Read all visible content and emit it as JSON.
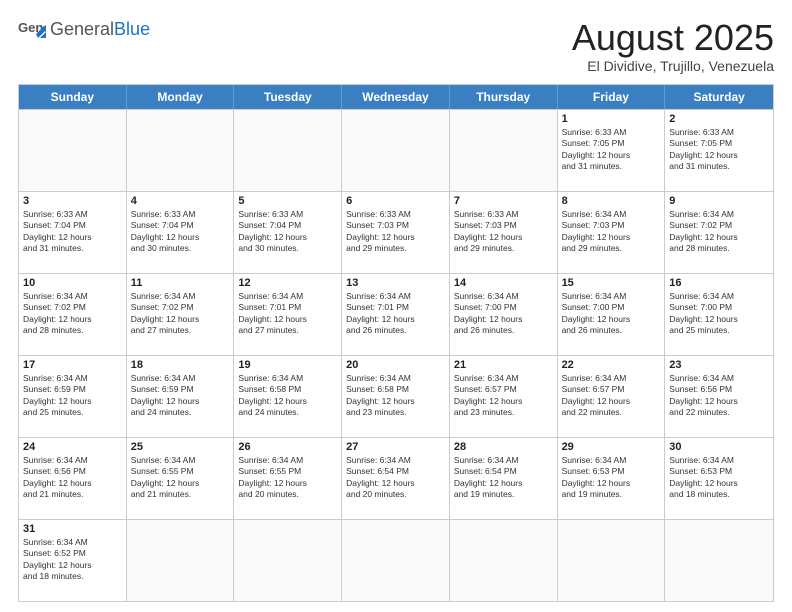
{
  "header": {
    "logo_general": "General",
    "logo_blue": "Blue",
    "month_title": "August 2025",
    "location": "El Dividive, Trujillo, Venezuela"
  },
  "weekdays": [
    "Sunday",
    "Monday",
    "Tuesday",
    "Wednesday",
    "Thursday",
    "Friday",
    "Saturday"
  ],
  "rows": [
    [
      {
        "day": "",
        "info": ""
      },
      {
        "day": "",
        "info": ""
      },
      {
        "day": "",
        "info": ""
      },
      {
        "day": "",
        "info": ""
      },
      {
        "day": "",
        "info": ""
      },
      {
        "day": "1",
        "info": "Sunrise: 6:33 AM\nSunset: 7:05 PM\nDaylight: 12 hours\nand 31 minutes."
      },
      {
        "day": "2",
        "info": "Sunrise: 6:33 AM\nSunset: 7:05 PM\nDaylight: 12 hours\nand 31 minutes."
      }
    ],
    [
      {
        "day": "3",
        "info": "Sunrise: 6:33 AM\nSunset: 7:04 PM\nDaylight: 12 hours\nand 31 minutes."
      },
      {
        "day": "4",
        "info": "Sunrise: 6:33 AM\nSunset: 7:04 PM\nDaylight: 12 hours\nand 30 minutes."
      },
      {
        "day": "5",
        "info": "Sunrise: 6:33 AM\nSunset: 7:04 PM\nDaylight: 12 hours\nand 30 minutes."
      },
      {
        "day": "6",
        "info": "Sunrise: 6:33 AM\nSunset: 7:03 PM\nDaylight: 12 hours\nand 29 minutes."
      },
      {
        "day": "7",
        "info": "Sunrise: 6:33 AM\nSunset: 7:03 PM\nDaylight: 12 hours\nand 29 minutes."
      },
      {
        "day": "8",
        "info": "Sunrise: 6:34 AM\nSunset: 7:03 PM\nDaylight: 12 hours\nand 29 minutes."
      },
      {
        "day": "9",
        "info": "Sunrise: 6:34 AM\nSunset: 7:02 PM\nDaylight: 12 hours\nand 28 minutes."
      }
    ],
    [
      {
        "day": "10",
        "info": "Sunrise: 6:34 AM\nSunset: 7:02 PM\nDaylight: 12 hours\nand 28 minutes."
      },
      {
        "day": "11",
        "info": "Sunrise: 6:34 AM\nSunset: 7:02 PM\nDaylight: 12 hours\nand 27 minutes."
      },
      {
        "day": "12",
        "info": "Sunrise: 6:34 AM\nSunset: 7:01 PM\nDaylight: 12 hours\nand 27 minutes."
      },
      {
        "day": "13",
        "info": "Sunrise: 6:34 AM\nSunset: 7:01 PM\nDaylight: 12 hours\nand 26 minutes."
      },
      {
        "day": "14",
        "info": "Sunrise: 6:34 AM\nSunset: 7:00 PM\nDaylight: 12 hours\nand 26 minutes."
      },
      {
        "day": "15",
        "info": "Sunrise: 6:34 AM\nSunset: 7:00 PM\nDaylight: 12 hours\nand 26 minutes."
      },
      {
        "day": "16",
        "info": "Sunrise: 6:34 AM\nSunset: 7:00 PM\nDaylight: 12 hours\nand 25 minutes."
      }
    ],
    [
      {
        "day": "17",
        "info": "Sunrise: 6:34 AM\nSunset: 6:59 PM\nDaylight: 12 hours\nand 25 minutes."
      },
      {
        "day": "18",
        "info": "Sunrise: 6:34 AM\nSunset: 6:59 PM\nDaylight: 12 hours\nand 24 minutes."
      },
      {
        "day": "19",
        "info": "Sunrise: 6:34 AM\nSunset: 6:58 PM\nDaylight: 12 hours\nand 24 minutes."
      },
      {
        "day": "20",
        "info": "Sunrise: 6:34 AM\nSunset: 6:58 PM\nDaylight: 12 hours\nand 23 minutes."
      },
      {
        "day": "21",
        "info": "Sunrise: 6:34 AM\nSunset: 6:57 PM\nDaylight: 12 hours\nand 23 minutes."
      },
      {
        "day": "22",
        "info": "Sunrise: 6:34 AM\nSunset: 6:57 PM\nDaylight: 12 hours\nand 22 minutes."
      },
      {
        "day": "23",
        "info": "Sunrise: 6:34 AM\nSunset: 6:56 PM\nDaylight: 12 hours\nand 22 minutes."
      }
    ],
    [
      {
        "day": "24",
        "info": "Sunrise: 6:34 AM\nSunset: 6:56 PM\nDaylight: 12 hours\nand 21 minutes."
      },
      {
        "day": "25",
        "info": "Sunrise: 6:34 AM\nSunset: 6:55 PM\nDaylight: 12 hours\nand 21 minutes."
      },
      {
        "day": "26",
        "info": "Sunrise: 6:34 AM\nSunset: 6:55 PM\nDaylight: 12 hours\nand 20 minutes."
      },
      {
        "day": "27",
        "info": "Sunrise: 6:34 AM\nSunset: 6:54 PM\nDaylight: 12 hours\nand 20 minutes."
      },
      {
        "day": "28",
        "info": "Sunrise: 6:34 AM\nSunset: 6:54 PM\nDaylight: 12 hours\nand 19 minutes."
      },
      {
        "day": "29",
        "info": "Sunrise: 6:34 AM\nSunset: 6:53 PM\nDaylight: 12 hours\nand 19 minutes."
      },
      {
        "day": "30",
        "info": "Sunrise: 6:34 AM\nSunset: 6:53 PM\nDaylight: 12 hours\nand 18 minutes."
      }
    ],
    [
      {
        "day": "31",
        "info": "Sunrise: 6:34 AM\nSunset: 6:52 PM\nDaylight: 12 hours\nand 18 minutes."
      },
      {
        "day": "",
        "info": ""
      },
      {
        "day": "",
        "info": ""
      },
      {
        "day": "",
        "info": ""
      },
      {
        "day": "",
        "info": ""
      },
      {
        "day": "",
        "info": ""
      },
      {
        "day": "",
        "info": ""
      }
    ]
  ]
}
